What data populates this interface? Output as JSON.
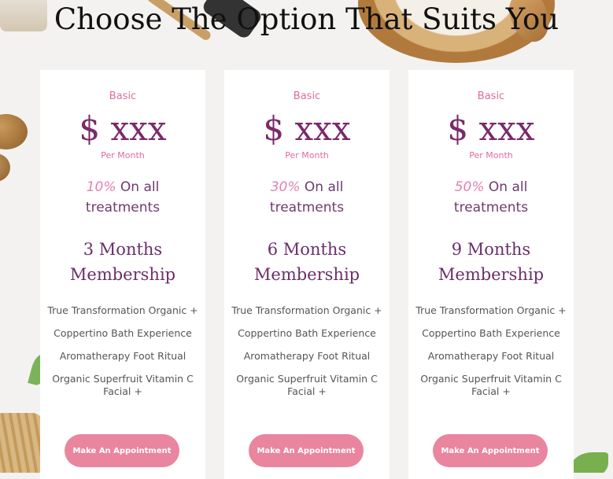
{
  "page": {
    "heading": "Choose The Option That Suits You"
  },
  "cards": [
    {
      "plan": "Basic",
      "price": "$ xxx",
      "period": "Per Month",
      "discount_pct": "10%",
      "discount_rest": " On all treatments",
      "membership": "3 Months Membership",
      "features": [
        "True Transformation Organic +",
        "Coppertino Bath Experience",
        "Aromatherapy Foot Ritual",
        "Organic Superfruit Vitamin C Facial +"
      ],
      "button": "Make An Appointment"
    },
    {
      "plan": "Basic",
      "price": "$ xxx",
      "period": "Per Month",
      "discount_pct": "30%",
      "discount_rest": " On all treatments",
      "membership": "6 Months Membership",
      "features": [
        "True Transformation Organic +",
        "Coppertino Bath Experience",
        "Aromatherapy Foot Ritual",
        "Organic Superfruit Vitamin C Facial +"
      ],
      "button": "Make An Appointment"
    },
    {
      "plan": "Basic",
      "price": "$ xxx",
      "period": "Per Month",
      "discount_pct": "50%",
      "discount_rest": " On all treatments",
      "membership": "9 Months Membership",
      "features": [
        "True Transformation Organic +",
        "Coppertino Bath Experience",
        "Aromatherapy Foot Ritual",
        "Organic Superfruit Vitamin C Facial +"
      ],
      "button": "Make An Appointment"
    }
  ],
  "colors": {
    "accent_pink": "#e9859f",
    "price_purple": "#7a2a6a",
    "label_pink": "#e06b9e"
  }
}
